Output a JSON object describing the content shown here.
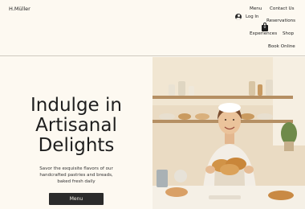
{
  "header": {
    "brand": "H.Müller",
    "nav": {
      "menu": "Menu",
      "contact": "Contact Us",
      "reservations": "Reservations",
      "experiences": "Experiences",
      "shop": "Shop",
      "book_online": "Book Online"
    },
    "login_label": "Log In",
    "cart_count": "0"
  },
  "hero": {
    "headline": [
      "Indulge in",
      "Artisanal",
      "Delights"
    ],
    "subtext": [
      "Savor the exquisite flavors of our",
      "handcrafted pastries and breads,",
      "baked fresh daily"
    ],
    "button_label": "Menu"
  },
  "icons": {
    "login": "user-avatar-icon",
    "cart": "shopping-bag-icon"
  },
  "colors": {
    "background": "#fdf9f1",
    "button": "#2b2b2b",
    "text": "#222222"
  }
}
